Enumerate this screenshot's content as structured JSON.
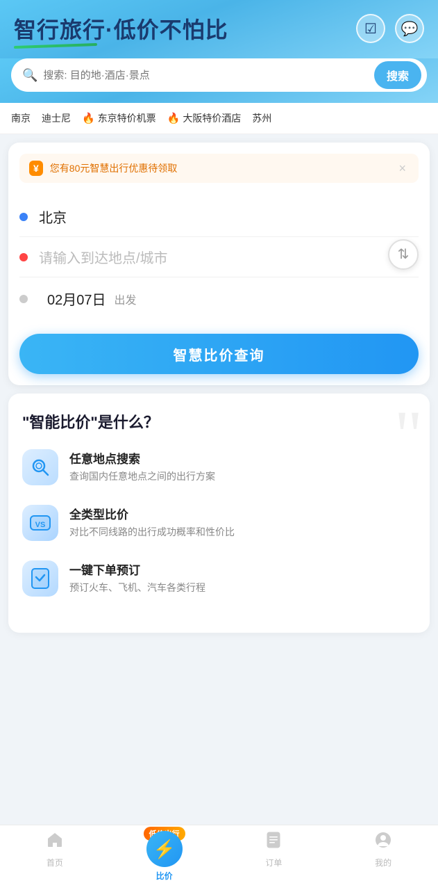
{
  "app": {
    "title": "智行旅行·低价不怕比"
  },
  "header": {
    "title": "智行旅行·低价不怕比",
    "icon_calendar": "☑",
    "icon_message": "💬"
  },
  "search_bar": {
    "placeholder": "搜索: 目的地·酒店·景点",
    "button_label": "搜索"
  },
  "tags": [
    {
      "label": "南京",
      "hot": false
    },
    {
      "label": "迪士尼",
      "hot": false
    },
    {
      "label": "东京特价机票",
      "hot": true
    },
    {
      "label": "大阪特价酒店",
      "hot": true
    },
    {
      "label": "苏州",
      "hot": false
    }
  ],
  "promo": {
    "icon": "¥",
    "text": "您有80元智慧出行优惠待领取",
    "close": "×"
  },
  "route": {
    "from": "北京",
    "to_placeholder": "请输入到达地点/城市",
    "date": "02月07日",
    "depart_label": "出发",
    "swap_icon": "⇅"
  },
  "search_button": {
    "label": "智慧比价查询"
  },
  "info": {
    "quote_char": "❝",
    "title": "\"智能比价\"是什么？",
    "features": [
      {
        "icon": "🔍",
        "title": "任意地点搜索",
        "desc": "查询国内任意地点之间的出行方案"
      },
      {
        "icon": "VS",
        "title": "全类型比价",
        "desc": "对比不同线路的出行成功概率和性价比"
      },
      {
        "icon": "📋",
        "title": "一键下单预订",
        "desc": "预订火车、飞机、汽车各类行程"
      }
    ]
  },
  "bottom_nav": [
    {
      "id": "home",
      "label": "首页",
      "icon": "🏠",
      "active": false
    },
    {
      "id": "compare",
      "label": "比价",
      "icon": "⚡",
      "active": true,
      "badge": "低价出行"
    },
    {
      "id": "orders",
      "label": "订单",
      "icon": "📄",
      "active": false
    },
    {
      "id": "profile",
      "label": "我的",
      "icon": "😶",
      "active": false
    }
  ]
}
